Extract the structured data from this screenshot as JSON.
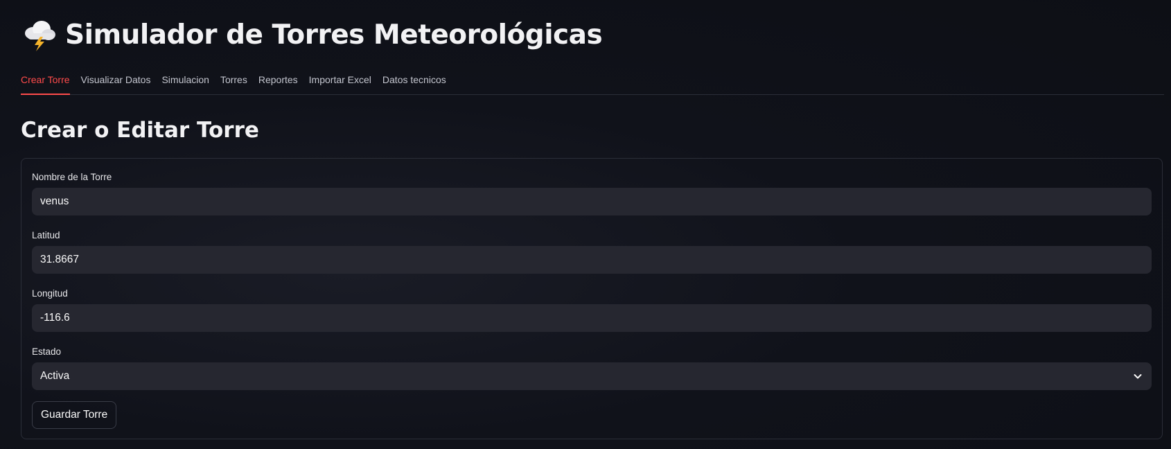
{
  "header": {
    "title": "Simulador de Torres Meteorológicas",
    "title_icon": "cloud-lightning-icon"
  },
  "tabs": [
    {
      "label": "Crear Torre",
      "active": true
    },
    {
      "label": "Visualizar Datos",
      "active": false
    },
    {
      "label": "Simulacion",
      "active": false
    },
    {
      "label": "Torres",
      "active": false
    },
    {
      "label": "Reportes",
      "active": false
    },
    {
      "label": "Importar Excel",
      "active": false
    },
    {
      "label": "Datos tecnicos",
      "active": false
    }
  ],
  "section": {
    "title": "Crear o Editar Torre"
  },
  "form": {
    "name_label": "Nombre de la Torre",
    "name_value": "venus",
    "lat_label": "Latitud",
    "lat_value": "31.8667",
    "lon_label": "Longitud",
    "lon_value": "-116.6",
    "state_label": "Estado",
    "state_value": "Activa",
    "save_label": "Guardar Torre"
  },
  "colors": {
    "accent": "#ff4b4b",
    "background": "#0e1117",
    "input_bg": "#262730",
    "border": "#2b2e38"
  }
}
